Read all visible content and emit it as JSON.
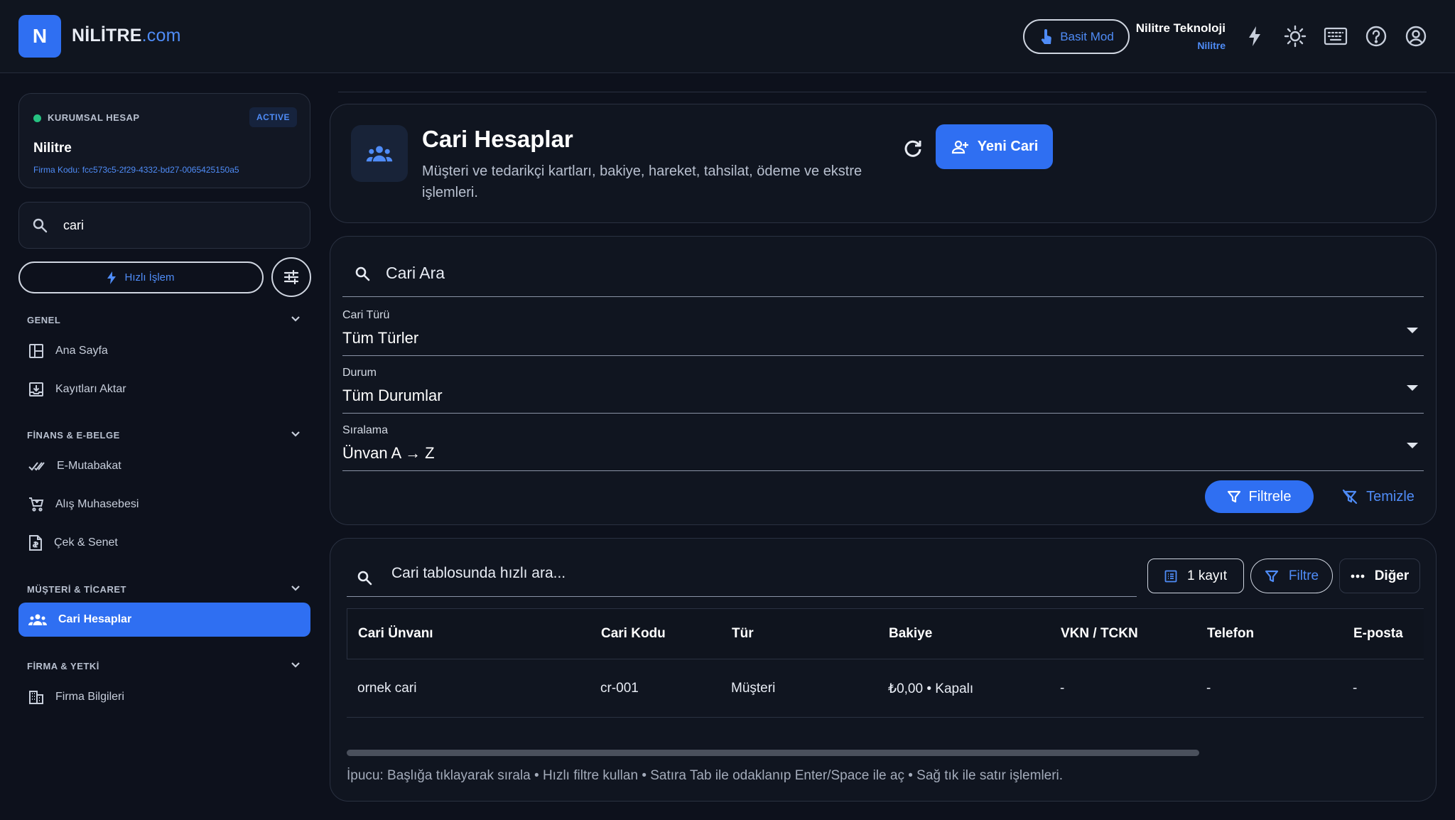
{
  "topbar": {
    "logo_letter": "N",
    "brand_main": "NİLİTRE",
    "brand_accent": ".com",
    "mode_label": "Basit Mod",
    "company_name": "Nilitre Teknoloji",
    "company_sub": "Nilitre",
    "icons": [
      "bolt-icon",
      "brightness-icon",
      "keyboard-icon",
      "help-icon",
      "account-icon"
    ]
  },
  "sidebar": {
    "account": {
      "label": "KURUMSAL HESAP",
      "badge": "ACTIVE",
      "name": "Nilitre",
      "code": "Firma Kodu: fcc573c5-2f29-4332-bd27-0065425150a5"
    },
    "search_value": "cari",
    "quick_label": "Hızlı İşlem",
    "sections": [
      {
        "title": "GENEL",
        "items": [
          {
            "label": "Ana Sayfa",
            "icon": "dashboard-icon"
          },
          {
            "label": "Kayıtları Aktar",
            "icon": "import-icon"
          }
        ]
      },
      {
        "title": "FİNANS & E-BELGE",
        "items": [
          {
            "label": "E-Mutabakat",
            "icon": "double-check-icon"
          },
          {
            "label": "Alış Muhasebesi",
            "icon": "cart-icon"
          },
          {
            "label": "Çek & Senet",
            "icon": "document-icon"
          }
        ]
      },
      {
        "title": "MÜŞTERİ & TİCARET",
        "items": [
          {
            "label": "Cari Hesaplar",
            "icon": "group-icon",
            "active": true
          }
        ]
      },
      {
        "title": "FİRMA & YETKİ",
        "items": [
          {
            "label": "Firma Bilgileri",
            "icon": "building-icon"
          }
        ]
      }
    ]
  },
  "header": {
    "title": "Cari Hesaplar",
    "description": "Müşteri ve tedarikçi kartları, bakiye, hareket, tahsilat, ödeme ve ekstre işlemleri.",
    "new_button": "Yeni Cari"
  },
  "filters": {
    "search_placeholder": "Cari Ara",
    "type": {
      "label": "Cari Türü",
      "value": "Tüm Türler"
    },
    "status": {
      "label": "Durum",
      "value": "Tüm Durumlar"
    },
    "sort": {
      "label": "Sıralama",
      "value": "Ünvan A → Z"
    },
    "apply_label": "Filtrele",
    "clear_label": "Temizle"
  },
  "table": {
    "search_placeholder": "Cari tablosunda hızlı ara...",
    "count_label": "1 kayıt",
    "filter_label": "Filtre",
    "more_label": "Diğer",
    "columns": [
      "Cari Ünvanı",
      "Cari Kodu",
      "Tür",
      "Bakiye",
      "VKN / TCKN",
      "Telefon",
      "E-posta"
    ],
    "rows": [
      [
        "ornek cari",
        "cr-001",
        "Müşteri",
        "₺0,00 • Kapalı",
        "-",
        "-",
        "-"
      ]
    ],
    "tip": "İpucu: Başlığa tıklayarak sırala • Hızlı filtre kullan • Satıra Tab ile odaklanıp Enter/Space ile aç • Sağ tık ile satır işlemleri."
  },
  "colors": {
    "accent": "#2f6ff2",
    "link": "#4f8cf7",
    "background": "#0d111c",
    "success": "#26c281"
  }
}
